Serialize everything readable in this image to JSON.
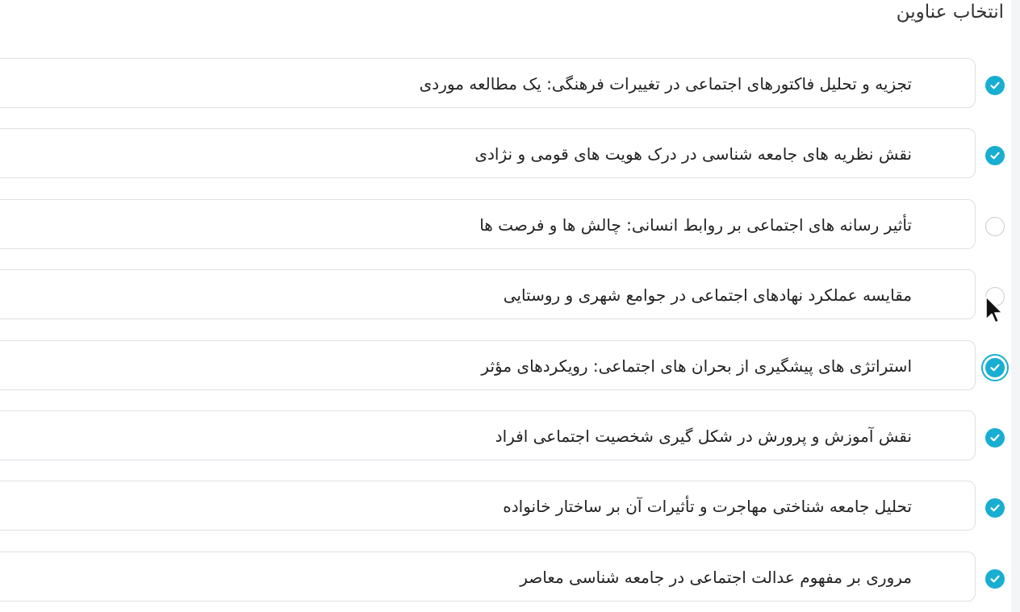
{
  "page": {
    "title": "انتخاب عناوین"
  },
  "colors": {
    "accent": "#18aed1",
    "border": "#dcdfe5",
    "unchecked_border": "#c9cdd4"
  },
  "topics": [
    {
      "label": "تجزیه و تحلیل فاکتورهای اجتماعی در تغییرات فرهنگی: یک مطالعه موردی",
      "checked": true
    },
    {
      "label": "نقش نظریه های جامعه شناسی در درک هویت های قومی و نژادی",
      "checked": true
    },
    {
      "label": "تأثیر رسانه های اجتماعی بر روابط انسانی: چالش ها و فرصت ها",
      "checked": false
    },
    {
      "label": "مقایسه عملکرد نهادهای اجتماعی در جوامع شهری و روستایی",
      "checked": false
    },
    {
      "label": "استراتژی های پیشگیری از بحران های اجتماعی: رویکردهای مؤثر",
      "checked": true
    },
    {
      "label": "نقش آموزش و پرورش در شکل گیری شخصیت اجتماعی افراد",
      "checked": true
    },
    {
      "label": "تحلیل جامعه شناختی مهاجرت و تأثیرات آن بر ساختار خانواده",
      "checked": true
    },
    {
      "label": "مروری بر مفهوم عدالت اجتماعی در جامعه شناسی معاصر",
      "checked": true
    }
  ],
  "icons": {
    "checked": "check-circle-icon",
    "unchecked": "empty-circle-icon",
    "cursor": "mouse-pointer-icon"
  }
}
